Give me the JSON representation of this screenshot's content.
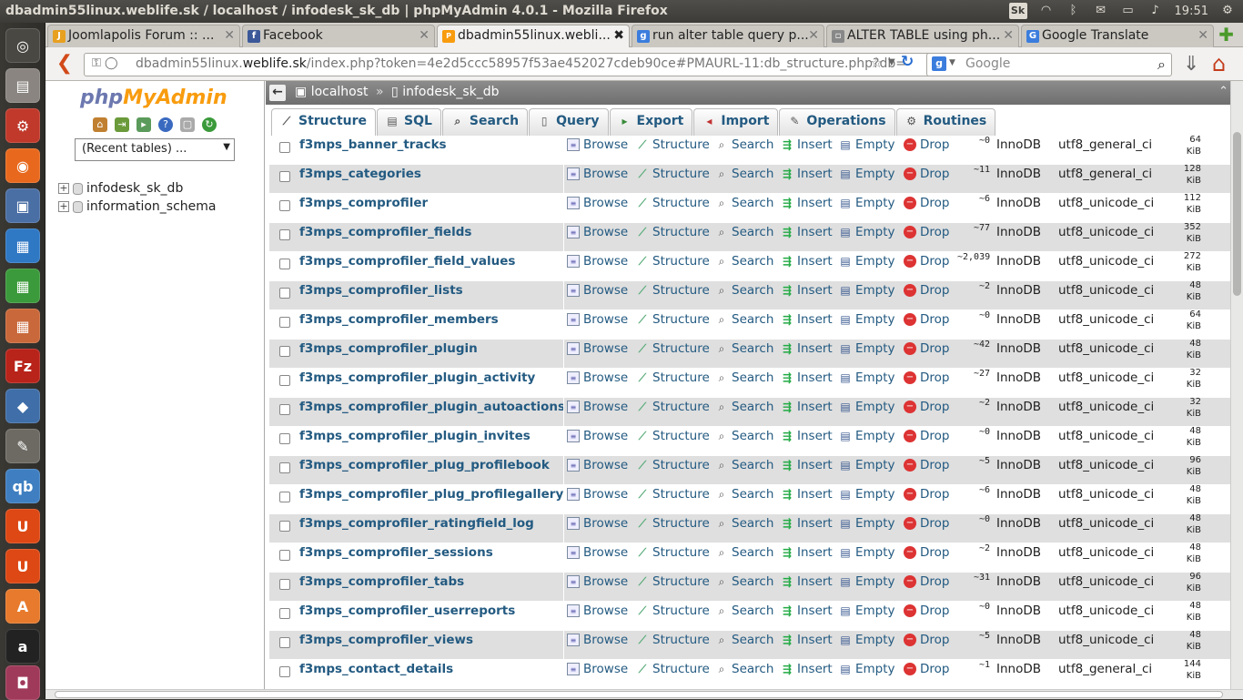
{
  "window_title": "dbadmin55linux.weblife.sk / localhost / infodesk_sk_db | phpMyAdmin 4.0.1 - Mozilla Firefox",
  "tray": {
    "keyboard": "Sk",
    "clock": "19:51"
  },
  "browser": {
    "tabs": [
      {
        "label": "Joomlapolis Forum :: ...",
        "active": false
      },
      {
        "label": "Facebook",
        "active": false
      },
      {
        "label": "dbadmin55linux.webli...",
        "active": true
      },
      {
        "label": "run alter table query p...",
        "active": false
      },
      {
        "label": "ALTER TABLE using ph...",
        "active": false
      },
      {
        "label": "Google Translate",
        "active": false
      }
    ],
    "url_prefix": "dbadmin55linux.",
    "url_host": "weblife.sk",
    "url_path": "/index.php?token=4e2d5ccc58957f53ae452027cdeb90ce#PMAURL-11:db_structure.php?db=",
    "search_placeholder": "Google"
  },
  "pma": {
    "logo_a": "php",
    "logo_b": "MyAdmin",
    "recent_tables": "(Recent tables) ...",
    "databases": [
      "infodesk_sk_db",
      "information_schema"
    ],
    "breadcrumb": {
      "server": "localhost",
      "separator": "»",
      "database": "infodesk_sk_db"
    },
    "tabs": [
      "Structure",
      "SQL",
      "Search",
      "Query",
      "Export",
      "Import",
      "Operations",
      "Routines"
    ],
    "actions": {
      "browse": "Browse",
      "structure": "Structure",
      "search": "Search",
      "insert": "Insert",
      "empty": "Empty",
      "drop": "Drop"
    },
    "size_unit": "KiB",
    "tables": [
      {
        "name": "f3mps_banner_tracks",
        "rows": "~0",
        "engine": "InnoDB",
        "collation": "utf8_general_ci",
        "size": "64"
      },
      {
        "name": "f3mps_categories",
        "rows": "~11",
        "engine": "InnoDB",
        "collation": "utf8_general_ci",
        "size": "128"
      },
      {
        "name": "f3mps_comprofiler",
        "rows": "~6",
        "engine": "InnoDB",
        "collation": "utf8_unicode_ci",
        "size": "112"
      },
      {
        "name": "f3mps_comprofiler_fields",
        "rows": "~77",
        "engine": "InnoDB",
        "collation": "utf8_unicode_ci",
        "size": "352"
      },
      {
        "name": "f3mps_comprofiler_field_values",
        "rows": "~2,039",
        "engine": "InnoDB",
        "collation": "utf8_unicode_ci",
        "size": "272"
      },
      {
        "name": "f3mps_comprofiler_lists",
        "rows": "~2",
        "engine": "InnoDB",
        "collation": "utf8_unicode_ci",
        "size": "48"
      },
      {
        "name": "f3mps_comprofiler_members",
        "rows": "~0",
        "engine": "InnoDB",
        "collation": "utf8_unicode_ci",
        "size": "64"
      },
      {
        "name": "f3mps_comprofiler_plugin",
        "rows": "~42",
        "engine": "InnoDB",
        "collation": "utf8_unicode_ci",
        "size": "48"
      },
      {
        "name": "f3mps_comprofiler_plugin_activity",
        "rows": "~27",
        "engine": "InnoDB",
        "collation": "utf8_unicode_ci",
        "size": "32"
      },
      {
        "name": "f3mps_comprofiler_plugin_autoactions",
        "rows": "~2",
        "engine": "InnoDB",
        "collation": "utf8_unicode_ci",
        "size": "32"
      },
      {
        "name": "f3mps_comprofiler_plugin_invites",
        "rows": "~0",
        "engine": "InnoDB",
        "collation": "utf8_unicode_ci",
        "size": "48"
      },
      {
        "name": "f3mps_comprofiler_plug_profilebook",
        "rows": "~5",
        "engine": "InnoDB",
        "collation": "utf8_unicode_ci",
        "size": "96"
      },
      {
        "name": "f3mps_comprofiler_plug_profilegallery",
        "rows": "~6",
        "engine": "InnoDB",
        "collation": "utf8_unicode_ci",
        "size": "48"
      },
      {
        "name": "f3mps_comprofiler_ratingfield_log",
        "rows": "~0",
        "engine": "InnoDB",
        "collation": "utf8_unicode_ci",
        "size": "48"
      },
      {
        "name": "f3mps_comprofiler_sessions",
        "rows": "~2",
        "engine": "InnoDB",
        "collation": "utf8_unicode_ci",
        "size": "48"
      },
      {
        "name": "f3mps_comprofiler_tabs",
        "rows": "~31",
        "engine": "InnoDB",
        "collation": "utf8_unicode_ci",
        "size": "96"
      },
      {
        "name": "f3mps_comprofiler_userreports",
        "rows": "~0",
        "engine": "InnoDB",
        "collation": "utf8_unicode_ci",
        "size": "48"
      },
      {
        "name": "f3mps_comprofiler_views",
        "rows": "~5",
        "engine": "InnoDB",
        "collation": "utf8_unicode_ci",
        "size": "48"
      },
      {
        "name": "f3mps_contact_details",
        "rows": "~1",
        "engine": "InnoDB",
        "collation": "utf8_general_ci",
        "size": "144"
      }
    ]
  }
}
